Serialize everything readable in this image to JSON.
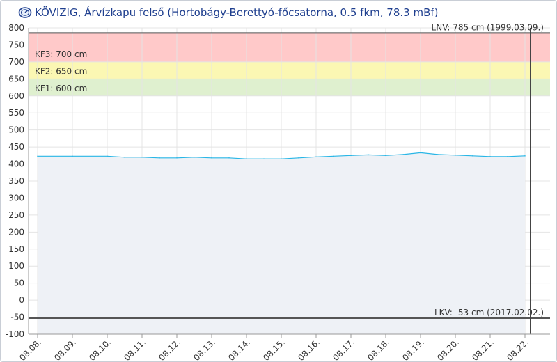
{
  "header": {
    "title": "KÖVIZIG, Árvízkapu felső (Hortobágy-Berettyó-főcsatorna, 0.5 fkm, 78.3 mBf)",
    "icon": "gauge-icon"
  },
  "colors": {
    "title": "#1f3f8f",
    "series": "#29b6e6",
    "area": "#eef1f6",
    "kf3": "#ffc9c9",
    "kf2": "#fbf7b3",
    "kf1": "#dff0cf",
    "grid": "#e4e4e4",
    "refline": "#555555"
  },
  "chart_data": {
    "type": "area",
    "ylim": [
      -100,
      800
    ],
    "yticks": [
      800,
      750,
      700,
      650,
      600,
      550,
      500,
      450,
      400,
      350,
      300,
      250,
      200,
      150,
      100,
      50,
      0,
      -50,
      -100
    ],
    "x_labels": [
      "08.08.",
      "08.09.",
      "08.10.",
      "08.11.",
      "08.12.",
      "08.13.",
      "08.14.",
      "08.15.",
      "08.16.",
      "08.17.",
      "08.18.",
      "08.19.",
      "08.20.",
      "08.21.",
      "08.22."
    ],
    "series": [
      {
        "points": [
          [
            0,
            423
          ],
          [
            1,
            423
          ],
          [
            2,
            423
          ],
          [
            2.5,
            420
          ],
          [
            3,
            420
          ],
          [
            3.5,
            418
          ],
          [
            4,
            418
          ],
          [
            4.5,
            420
          ],
          [
            5,
            418
          ],
          [
            5.5,
            418
          ],
          [
            6,
            415
          ],
          [
            6.5,
            415
          ],
          [
            7,
            415
          ],
          [
            7.5,
            418
          ],
          [
            8,
            421
          ],
          [
            8.5,
            423
          ],
          [
            9,
            425
          ],
          [
            9.5,
            427
          ],
          [
            10,
            425
          ],
          [
            10.5,
            428
          ],
          [
            11,
            433
          ],
          [
            11.5,
            428
          ],
          [
            12,
            426
          ],
          [
            12.5,
            424
          ],
          [
            13,
            422
          ],
          [
            13.5,
            422
          ],
          [
            14,
            424
          ]
        ]
      }
    ],
    "bands": [
      {
        "label": "KF3: 700 cm",
        "from": 700,
        "to": 785,
        "color_key": "kf3"
      },
      {
        "label": "KF2: 650 cm",
        "from": 650,
        "to": 700,
        "color_key": "kf2"
      },
      {
        "label": "KF1: 600 cm",
        "from": 600,
        "to": 650,
        "color_key": "kf1"
      }
    ],
    "reference_lines": [
      {
        "label": "LNV: 785 cm (1999.03.09.)",
        "value": 785
      },
      {
        "label": "LKV: -53 cm (2017.02.02.)",
        "value": -53
      }
    ],
    "current_marker_x": 14.15,
    "grid": true
  }
}
